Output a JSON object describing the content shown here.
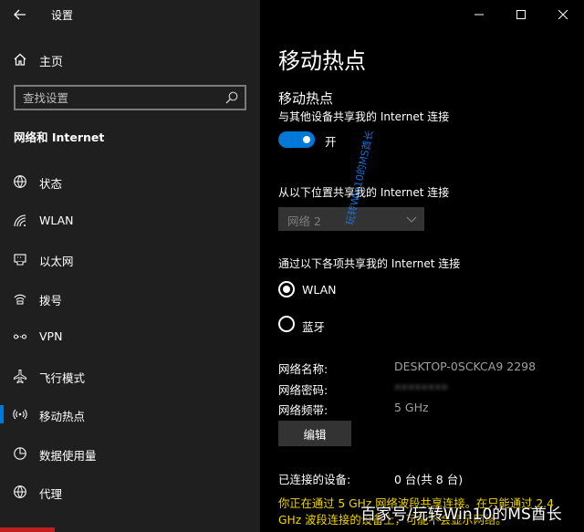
{
  "sidebar": {
    "window_title": "设置",
    "home_label": "主页",
    "search_placeholder": "查找设置",
    "section_title": "网络和 Internet",
    "items": [
      {
        "label": "状态",
        "icon": "globe-icon"
      },
      {
        "label": "WLAN",
        "icon": "wifi-icon"
      },
      {
        "label": "以太网",
        "icon": "ethernet-icon"
      },
      {
        "label": "拨号",
        "icon": "dialup-icon"
      },
      {
        "label": "VPN",
        "icon": "vpn-icon"
      },
      {
        "label": "飞行模式",
        "icon": "airplane-icon"
      },
      {
        "label": "移动热点",
        "icon": "hotspot-icon",
        "active": true
      },
      {
        "label": "数据使用量",
        "icon": "data-usage-icon"
      },
      {
        "label": "代理",
        "icon": "globe-proxy-icon"
      }
    ]
  },
  "main": {
    "page_title": "移动热点",
    "sub_heading": "移动热点",
    "share_desc": "与其他设备共享我的 Internet 连接",
    "toggle_label": "开",
    "toggle_on": true,
    "share_from_label": "从以下位置共享我的 Internet 连接",
    "share_from_value": "网络 2",
    "share_over_label": "通过以下各项共享我的 Internet 连接",
    "radio_wlan": "WLAN",
    "radio_bluetooth": "蓝牙",
    "network_name_label": "网络名称:",
    "network_name_value": "DESKTOP-0SCKCA9 2298",
    "network_password_label": "网络密码:",
    "network_password_value": "••••••••",
    "network_band_label": "网络频带:",
    "network_band_value": "5 GHz",
    "edit_button": "编辑",
    "connected_label": "已连接的设备:",
    "connected_value": "0 台(共 8 台)",
    "warning_text": "你正在通过 5 GHz 网络波段共享连接。在只能通过 2.4 GHz 波段连接的设备上，可能不会显示网络。"
  },
  "watermarks": {
    "diagonal": "玩转Win10的MS酋长",
    "bottom": "百家号/玩转Win10的MS酋长"
  },
  "colors": {
    "accent": "#0078d7",
    "warning": "#f2d600",
    "sidebar_bg": "#1f1f1f",
    "content_bg": "#000000"
  }
}
